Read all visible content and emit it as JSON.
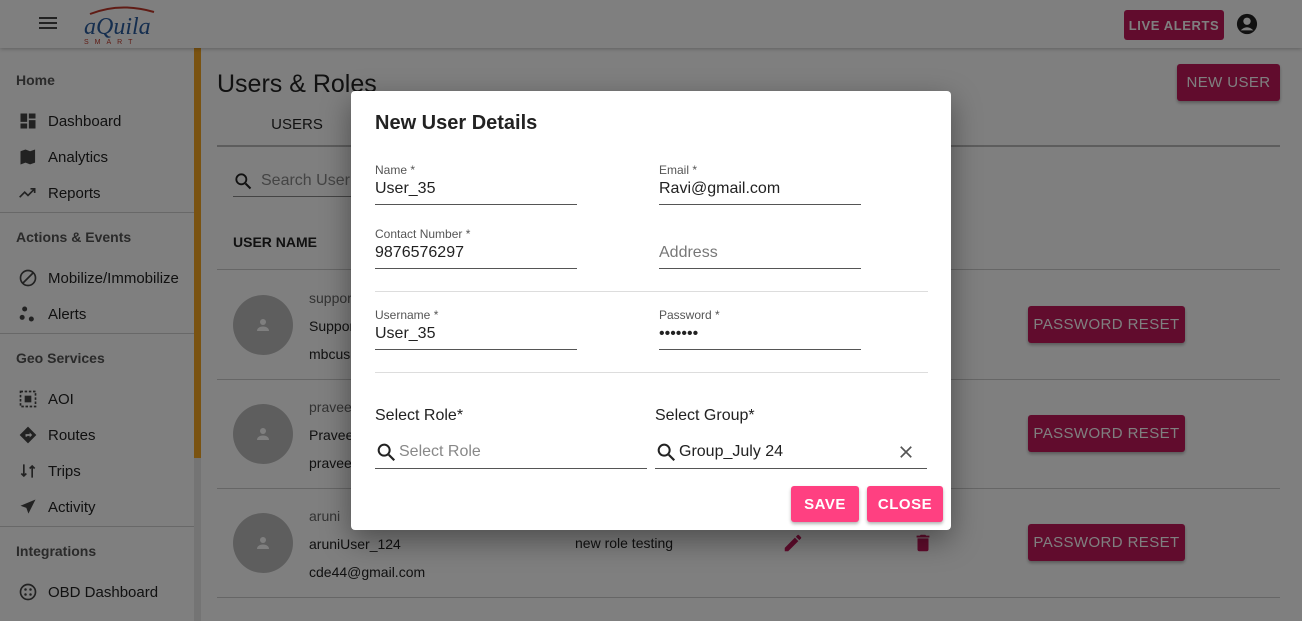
{
  "header": {
    "logo_text": "aQuila",
    "live_alerts_label": "LIVE ALERTS"
  },
  "sidebar": {
    "sections": [
      {
        "title": "Home",
        "items": [
          {
            "label": "Dashboard",
            "icon": "dashboard-icon"
          },
          {
            "label": "Analytics",
            "icon": "map-icon"
          },
          {
            "label": "Reports",
            "icon": "trending-icon"
          }
        ]
      },
      {
        "title": "Actions & Events",
        "items": [
          {
            "label": "Mobilize/Immobilize",
            "icon": "block-icon"
          },
          {
            "label": "Alerts",
            "icon": "scatter-icon"
          }
        ]
      },
      {
        "title": "Geo Services",
        "items": [
          {
            "label": "AOI",
            "icon": "select-area-icon"
          },
          {
            "label": "Routes",
            "icon": "directions-icon"
          },
          {
            "label": "Trips",
            "icon": "swap-icon"
          },
          {
            "label": "Activity",
            "icon": "navigation-icon"
          }
        ]
      },
      {
        "title": "Integrations",
        "items": [
          {
            "label": "OBD Dashboard",
            "icon": "obd-icon"
          }
        ]
      }
    ]
  },
  "main": {
    "page_title": "Users & Roles",
    "new_user_label": "NEW USER",
    "tab_users": "USERS",
    "search_placeholder": "Search User",
    "col_user_name": "USER NAME",
    "rows": [
      {
        "line1": "suppor",
        "line2": "Suppor",
        "line3": "mbcus",
        "reset": "PASSWORD RESET"
      },
      {
        "line1": "pravee",
        "line2": "Pravee",
        "line3": "pravee",
        "reset": "PASSWORD RESET"
      },
      {
        "line1": "aruni",
        "line2": "aruniUser_124",
        "line3": "cde44@gmail.com",
        "role": "new role testing",
        "reset": "PASSWORD RESET"
      }
    ]
  },
  "dialog": {
    "title": "New User Details",
    "name_label": "Name *",
    "name_value": "User_35",
    "email_label": "Email *",
    "email_value": "Ravi@gmail.com",
    "contact_label": "Contact Number *",
    "contact_value": "9876576297",
    "address_placeholder": "Address",
    "username_label": "Username *",
    "username_value": "User_35",
    "password_label": "Password *",
    "password_value": "•••••••",
    "select_role_label": "Select Role*",
    "select_role_placeholder": "Select Role",
    "select_group_label": "Select Group*",
    "select_group_value": "Group_July 24",
    "save_label": "SAVE",
    "close_label": "CLOSE"
  },
  "colors": {
    "primary": "#c2185b",
    "accent": "#ff4081",
    "sidebar_scroll": "#f5a623"
  }
}
